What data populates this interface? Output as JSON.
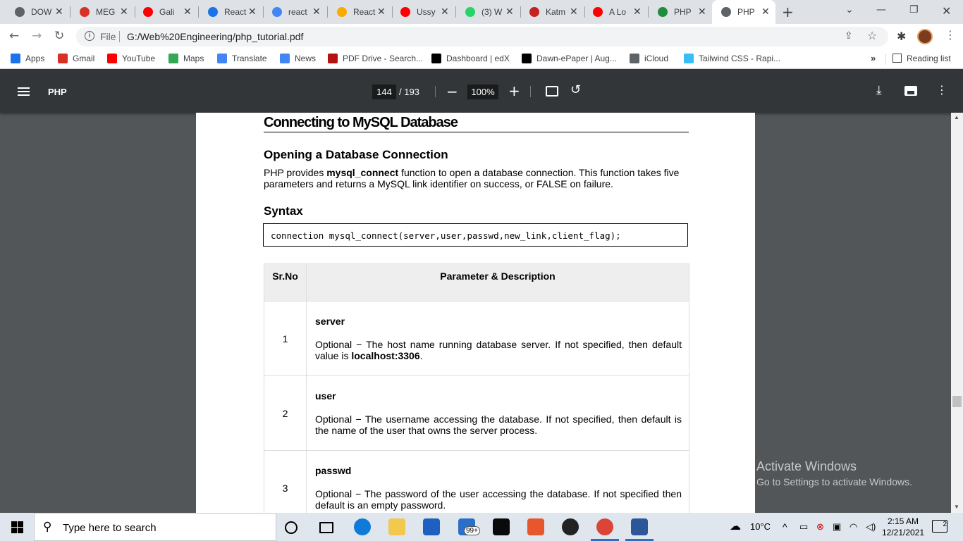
{
  "browser": {
    "tabs": [
      {
        "title": "DOW",
        "favicon": "globe-icon",
        "color": "#5f6368"
      },
      {
        "title": "MEG",
        "favicon": "mega-icon",
        "color": "#d93025"
      },
      {
        "title": "Gali",
        "favicon": "youtube-icon",
        "color": "#ff0000"
      },
      {
        "title": "React",
        "favicon": "info-icon",
        "color": "#1a73e8"
      },
      {
        "title": "react",
        "favicon": "google-icon",
        "color": "#4285f4"
      },
      {
        "title": "React",
        "favicon": "bee-icon",
        "color": "#f9ab00"
      },
      {
        "title": "Ussy",
        "favicon": "youtube-icon",
        "color": "#ff0000"
      },
      {
        "title": "(3) W",
        "favicon": "whatsapp-icon",
        "color": "#25d366"
      },
      {
        "title": "Katm",
        "favicon": "ladybug-icon",
        "color": "#c5221f"
      },
      {
        "title": "A Lo",
        "favicon": "youtube-icon",
        "color": "#ff0000"
      },
      {
        "title": "PHP",
        "favicon": "w-icon",
        "color": "#1e8e3e"
      },
      {
        "title": "PHP",
        "favicon": "globe-icon",
        "color": "#5f6368"
      }
    ],
    "active_tab": 11,
    "address": {
      "scheme_label": "File",
      "url": "G:/Web%20Engineering/php_tutorial.pdf"
    },
    "bookmarks": [
      {
        "label": "Apps",
        "icon": "apps-grid-icon",
        "color": "#1a73e8"
      },
      {
        "label": "Gmail",
        "icon": "gmail-icon",
        "color": "#d93025"
      },
      {
        "label": "YouTube",
        "icon": "youtube-icon",
        "color": "#ff0000"
      },
      {
        "label": "Maps",
        "icon": "maps-icon",
        "color": "#34a853"
      },
      {
        "label": "Translate",
        "icon": "translate-icon",
        "color": "#4285f4"
      },
      {
        "label": "News",
        "icon": "news-icon",
        "color": "#4285f4"
      },
      {
        "label": "PDF Drive - Search...",
        "icon": "pdfdrive-icon",
        "color": "#b31412"
      },
      {
        "label": "Dashboard | edX",
        "icon": "edx-icon",
        "color": "#000000"
      },
      {
        "label": "Dawn-ePaper | Aug...",
        "icon": "dawn-icon",
        "color": "#000000"
      },
      {
        "label": "iCloud",
        "icon": "apple-icon",
        "color": "#5f6368"
      },
      {
        "label": "Tailwind CSS - Rapi...",
        "icon": "tailwind-icon",
        "color": "#38bdf8"
      }
    ],
    "bookmarks_more": "»",
    "reading_list": "Reading list"
  },
  "pdf_viewer": {
    "title": "PHP",
    "current_page": "144",
    "total_pages": "/ 193",
    "zoom": "100%"
  },
  "document": {
    "heading": "Connecting to MySQL Database",
    "subheading": "Opening a Database Connection",
    "para_before": "PHP provides ",
    "para_bold": "mysql_connect",
    "para_after": " function to open a database connection. This function takes five parameters and returns a MySQL link identifier on success, or FALSE on failure.",
    "syntax_heading": "Syntax",
    "syntax_code": "connection mysql_connect(server,user,passwd,new_link,client_flag);",
    "table": {
      "headers": [
        "Sr.No",
        "Parameter & Description"
      ],
      "rows": [
        {
          "num": "1",
          "name": "server",
          "desc": "Optional − The host name running database server. If not specified, then default value is ",
          "desc_bold": "localhost:3306",
          "desc_end": "."
        },
        {
          "num": "2",
          "name": "user",
          "desc": "Optional − The username accessing the database. If not specified, then default is the name of the user that owns the server process.",
          "desc_bold": "",
          "desc_end": ""
        },
        {
          "num": "3",
          "name": "passwd",
          "desc": "Optional − The password of the user accessing the database. If not specified then default is an empty password.",
          "desc_bold": "",
          "desc_end": ""
        }
      ]
    }
  },
  "watermark": {
    "line1": "Activate Windows",
    "line2": "Go to Settings to activate Windows."
  },
  "taskbar": {
    "search_placeholder": "Type here to search",
    "weather": "10°C",
    "time": "2:15 AM",
    "date": "12/21/2021",
    "mail_badge": "99+",
    "notification_count": "2"
  }
}
